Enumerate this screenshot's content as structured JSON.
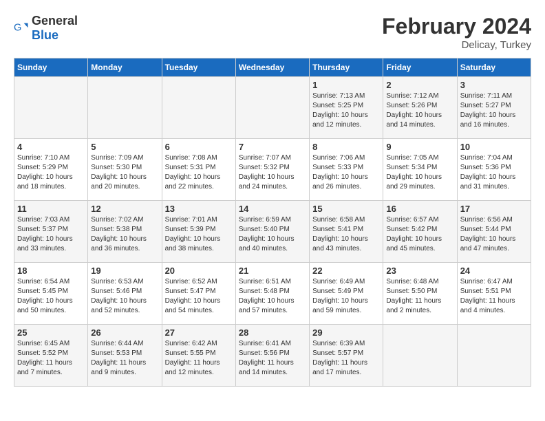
{
  "header": {
    "logo_general": "General",
    "logo_blue": "Blue",
    "title": "February 2024",
    "subtitle": "Delicay, Turkey"
  },
  "days_of_week": [
    "Sunday",
    "Monday",
    "Tuesday",
    "Wednesday",
    "Thursday",
    "Friday",
    "Saturday"
  ],
  "weeks": [
    {
      "days": [
        {
          "number": "",
          "info": ""
        },
        {
          "number": "",
          "info": ""
        },
        {
          "number": "",
          "info": ""
        },
        {
          "number": "",
          "info": ""
        },
        {
          "number": "1",
          "info": "Sunrise: 7:13 AM\nSunset: 5:25 PM\nDaylight: 10 hours\nand 12 minutes."
        },
        {
          "number": "2",
          "info": "Sunrise: 7:12 AM\nSunset: 5:26 PM\nDaylight: 10 hours\nand 14 minutes."
        },
        {
          "number": "3",
          "info": "Sunrise: 7:11 AM\nSunset: 5:27 PM\nDaylight: 10 hours\nand 16 minutes."
        }
      ]
    },
    {
      "days": [
        {
          "number": "4",
          "info": "Sunrise: 7:10 AM\nSunset: 5:29 PM\nDaylight: 10 hours\nand 18 minutes."
        },
        {
          "number": "5",
          "info": "Sunrise: 7:09 AM\nSunset: 5:30 PM\nDaylight: 10 hours\nand 20 minutes."
        },
        {
          "number": "6",
          "info": "Sunrise: 7:08 AM\nSunset: 5:31 PM\nDaylight: 10 hours\nand 22 minutes."
        },
        {
          "number": "7",
          "info": "Sunrise: 7:07 AM\nSunset: 5:32 PM\nDaylight: 10 hours\nand 24 minutes."
        },
        {
          "number": "8",
          "info": "Sunrise: 7:06 AM\nSunset: 5:33 PM\nDaylight: 10 hours\nand 26 minutes."
        },
        {
          "number": "9",
          "info": "Sunrise: 7:05 AM\nSunset: 5:34 PM\nDaylight: 10 hours\nand 29 minutes."
        },
        {
          "number": "10",
          "info": "Sunrise: 7:04 AM\nSunset: 5:36 PM\nDaylight: 10 hours\nand 31 minutes."
        }
      ]
    },
    {
      "days": [
        {
          "number": "11",
          "info": "Sunrise: 7:03 AM\nSunset: 5:37 PM\nDaylight: 10 hours\nand 33 minutes."
        },
        {
          "number": "12",
          "info": "Sunrise: 7:02 AM\nSunset: 5:38 PM\nDaylight: 10 hours\nand 36 minutes."
        },
        {
          "number": "13",
          "info": "Sunrise: 7:01 AM\nSunset: 5:39 PM\nDaylight: 10 hours\nand 38 minutes."
        },
        {
          "number": "14",
          "info": "Sunrise: 6:59 AM\nSunset: 5:40 PM\nDaylight: 10 hours\nand 40 minutes."
        },
        {
          "number": "15",
          "info": "Sunrise: 6:58 AM\nSunset: 5:41 PM\nDaylight: 10 hours\nand 43 minutes."
        },
        {
          "number": "16",
          "info": "Sunrise: 6:57 AM\nSunset: 5:42 PM\nDaylight: 10 hours\nand 45 minutes."
        },
        {
          "number": "17",
          "info": "Sunrise: 6:56 AM\nSunset: 5:44 PM\nDaylight: 10 hours\nand 47 minutes."
        }
      ]
    },
    {
      "days": [
        {
          "number": "18",
          "info": "Sunrise: 6:54 AM\nSunset: 5:45 PM\nDaylight: 10 hours\nand 50 minutes."
        },
        {
          "number": "19",
          "info": "Sunrise: 6:53 AM\nSunset: 5:46 PM\nDaylight: 10 hours\nand 52 minutes."
        },
        {
          "number": "20",
          "info": "Sunrise: 6:52 AM\nSunset: 5:47 PM\nDaylight: 10 hours\nand 54 minutes."
        },
        {
          "number": "21",
          "info": "Sunrise: 6:51 AM\nSunset: 5:48 PM\nDaylight: 10 hours\nand 57 minutes."
        },
        {
          "number": "22",
          "info": "Sunrise: 6:49 AM\nSunset: 5:49 PM\nDaylight: 10 hours\nand 59 minutes."
        },
        {
          "number": "23",
          "info": "Sunrise: 6:48 AM\nSunset: 5:50 PM\nDaylight: 11 hours\nand 2 minutes."
        },
        {
          "number": "24",
          "info": "Sunrise: 6:47 AM\nSunset: 5:51 PM\nDaylight: 11 hours\nand 4 minutes."
        }
      ]
    },
    {
      "days": [
        {
          "number": "25",
          "info": "Sunrise: 6:45 AM\nSunset: 5:52 PM\nDaylight: 11 hours\nand 7 minutes."
        },
        {
          "number": "26",
          "info": "Sunrise: 6:44 AM\nSunset: 5:53 PM\nDaylight: 11 hours\nand 9 minutes."
        },
        {
          "number": "27",
          "info": "Sunrise: 6:42 AM\nSunset: 5:55 PM\nDaylight: 11 hours\nand 12 minutes."
        },
        {
          "number": "28",
          "info": "Sunrise: 6:41 AM\nSunset: 5:56 PM\nDaylight: 11 hours\nand 14 minutes."
        },
        {
          "number": "29",
          "info": "Sunrise: 6:39 AM\nSunset: 5:57 PM\nDaylight: 11 hours\nand 17 minutes."
        },
        {
          "number": "",
          "info": ""
        },
        {
          "number": "",
          "info": ""
        }
      ]
    }
  ]
}
